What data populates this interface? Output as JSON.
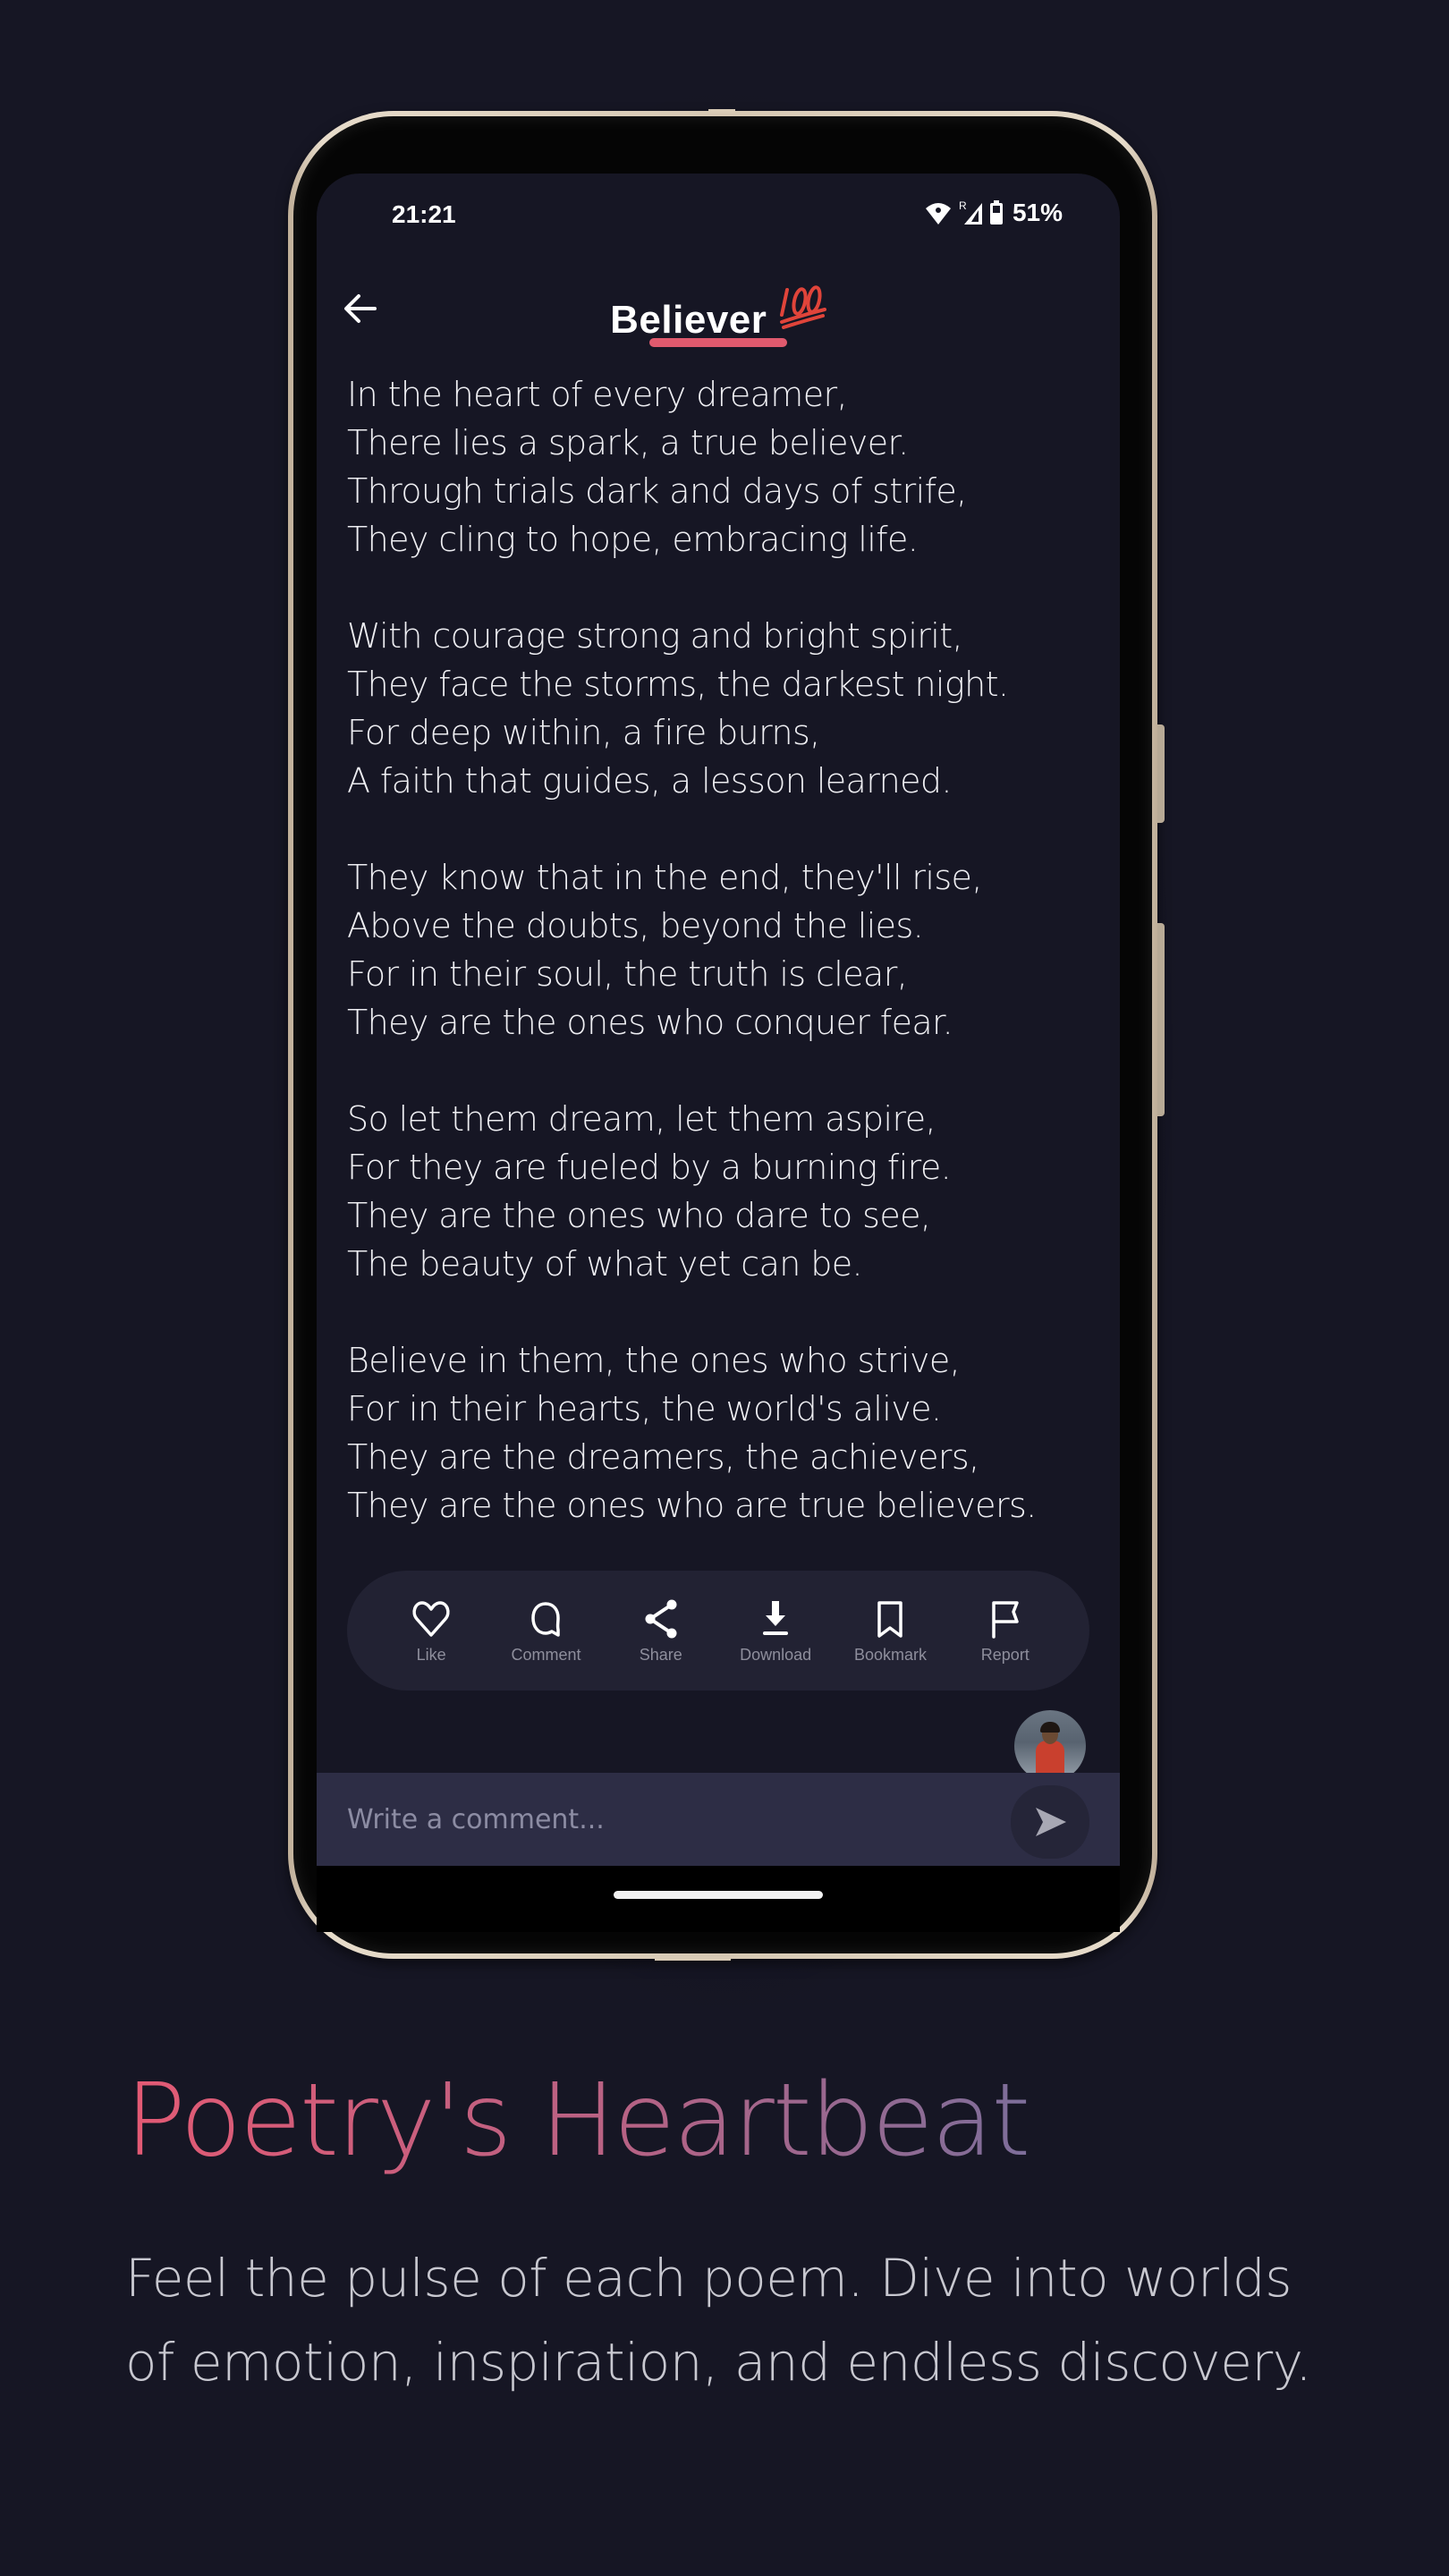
{
  "status_bar": {
    "time": "21:21",
    "battery_percent": "51%",
    "network_badge": "R",
    "icons": [
      "wifi-icon",
      "cellular-signal-icon",
      "battery-icon"
    ]
  },
  "header": {
    "title": "Believer",
    "title_emoji": "hundred-points-icon",
    "back_icon": "arrow-left-icon",
    "accent_color": "#e05a6e"
  },
  "poem": {
    "stanzas": [
      [
        "In the heart of every dreamer,",
        "There lies a spark, a true believer.",
        "Through trials dark and days of strife,",
        "They cling to hope, embracing life."
      ],
      [
        "With courage strong and bright spirit,",
        "They face the storms, the darkest night.",
        "For deep within, a fire burns,",
        "A faith that guides, a lesson learned."
      ],
      [
        "They know that in the end, they'll rise,",
        "Above the doubts, beyond the lies.",
        "For in their soul, the truth is clear,",
        "They are the ones who conquer fear."
      ],
      [
        "So let them dream, let them aspire,",
        "For they are fueled by a burning fire.",
        "They are the ones who dare to see,",
        "The beauty of what yet can be."
      ],
      [
        "Believe in them, the ones who strive,",
        "For in their hearts, the world's alive.",
        "They are the dreamers, the achievers,",
        "They are the ones who are true believers."
      ]
    ]
  },
  "actions": [
    {
      "label": "Like",
      "icon": "heart-icon"
    },
    {
      "label": "Comment",
      "icon": "comment-icon"
    },
    {
      "label": "Share",
      "icon": "share-icon"
    },
    {
      "label": "Download",
      "icon": "download-icon"
    },
    {
      "label": "Bookmark",
      "icon": "bookmark-icon"
    },
    {
      "label": "Report",
      "icon": "flag-icon"
    }
  ],
  "comment": {
    "placeholder": "Write a comment...",
    "value": "",
    "send_icon": "send-icon"
  },
  "promo": {
    "headline": "Poetry's Heartbeat",
    "description": "Feel the pulse of each poem. Dive into worlds of emotion, inspiration, and endless discovery.",
    "gradient_colors": [
      "#e35a74",
      "#b76284",
      "#7d6e9a"
    ]
  },
  "colors": {
    "background": "#161624",
    "action_bar": "#222233",
    "comment_bar": "#2d2d45"
  }
}
